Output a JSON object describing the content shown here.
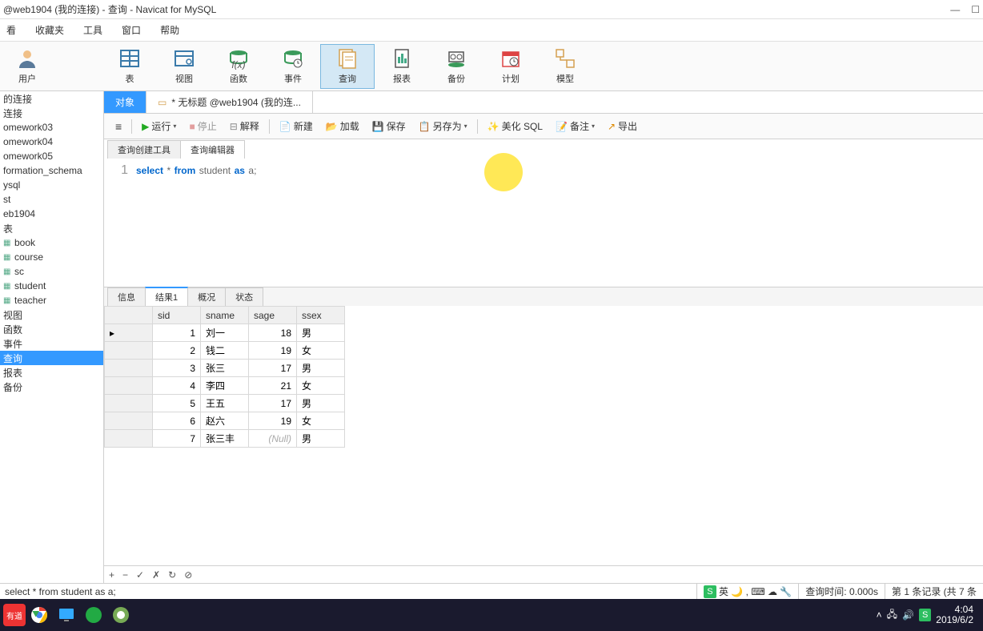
{
  "titlebar": {
    "text": "@web1904 (我的连接) - 查询 - Navicat for MySQL"
  },
  "menu": {
    "view": "看",
    "favorites": "收藏夹",
    "tools": "工具",
    "window": "窗口",
    "help": "帮助"
  },
  "toolbar": {
    "user": "用户",
    "table": "表",
    "view": "视图",
    "function": "函数",
    "event": "事件",
    "query": "查询",
    "report": "报表",
    "backup": "备份",
    "schedule": "计划",
    "model": "模型"
  },
  "sidebar": {
    "items": [
      {
        "label": "的连接",
        "icon": ""
      },
      {
        "label": "连接",
        "icon": ""
      },
      {
        "label": "omework03",
        "icon": ""
      },
      {
        "label": "omework04",
        "icon": ""
      },
      {
        "label": "omework05",
        "icon": ""
      },
      {
        "label": "formation_schema",
        "icon": ""
      },
      {
        "label": "ysql",
        "icon": ""
      },
      {
        "label": "st",
        "icon": ""
      },
      {
        "label": "eb1904",
        "icon": ""
      },
      {
        "label": "表",
        "icon": ""
      },
      {
        "label": "book",
        "icon": "▦"
      },
      {
        "label": "course",
        "icon": "▦"
      },
      {
        "label": "sc",
        "icon": "▦"
      },
      {
        "label": "student",
        "icon": "▦"
      },
      {
        "label": "teacher",
        "icon": "▦"
      },
      {
        "label": "视图",
        "icon": ""
      },
      {
        "label": "函数",
        "icon": ""
      },
      {
        "label": "事件",
        "icon": ""
      },
      {
        "label": "查询",
        "icon": "",
        "sel": true
      },
      {
        "label": "报表",
        "icon": ""
      },
      {
        "label": "备份",
        "icon": ""
      }
    ]
  },
  "tabs": {
    "objects": "对象",
    "query_tab": "* 无标题 @web1904 (我的连..."
  },
  "actions": {
    "run": "运行",
    "stop": "停止",
    "explain": "解释",
    "new": "新建",
    "load": "加载",
    "save": "保存",
    "saveas": "另存为",
    "beautify": "美化 SQL",
    "note": "备注",
    "export": "导出"
  },
  "subtabs": {
    "builder": "查询创建工具",
    "editor": "查询编辑器"
  },
  "editor": {
    "line_num": "1",
    "code_select": "select",
    "code_star": "*",
    "code_from": "from",
    "code_table": "student",
    "code_as": "as",
    "code_alias": "a",
    "code_semi": ";"
  },
  "result_tabs": {
    "info": "信息",
    "result1": "结果1",
    "profile": "概况",
    "status": "状态"
  },
  "grid": {
    "headers": [
      "sid",
      "sname",
      "sage",
      "ssex"
    ],
    "rows": [
      {
        "sid": "1",
        "sname": "刘一",
        "sage": "18",
        "ssex": "男",
        "current": true
      },
      {
        "sid": "2",
        "sname": "钱二",
        "sage": "19",
        "ssex": "女"
      },
      {
        "sid": "3",
        "sname": "张三",
        "sage": "17",
        "ssex": "男"
      },
      {
        "sid": "4",
        "sname": "李四",
        "sage": "21",
        "ssex": "女"
      },
      {
        "sid": "5",
        "sname": "王五",
        "sage": "17",
        "ssex": "男"
      },
      {
        "sid": "6",
        "sname": "赵六",
        "sage": "19",
        "ssex": "女"
      },
      {
        "sid": "7",
        "sname": "张三丰",
        "sage": "(Null)",
        "ssex": "男",
        "null_age": true
      }
    ]
  },
  "status": {
    "sql": "select * from student as a;",
    "ime": "英",
    "query_time": "查询时间: 0.000s",
    "record": "第 1 条记录 (共 7 条"
  },
  "taskbar": {
    "time": "4:04",
    "date": "2019/6/2"
  }
}
